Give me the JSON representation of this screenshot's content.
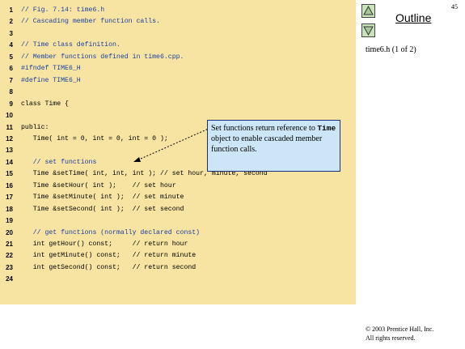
{
  "slide_number": "45",
  "outline_label": "Outline",
  "file_label": "time6.h (1 of 2)",
  "copyright": [
    "© 2003 Prentice Hall, Inc.",
    "All rights reserved."
  ],
  "callout": {
    "part1": "Set functions return reference to ",
    "code": "Time",
    "part2": " object to enable cascaded member function calls."
  },
  "code_lines": [
    {
      "n": "1",
      "t": "// Fig. 7.14: time6.h",
      "k": "cmt"
    },
    {
      "n": "2",
      "t": "// Cascading member function calls.",
      "k": "cmt"
    },
    {
      "n": "3",
      "t": "",
      "k": ""
    },
    {
      "n": "4",
      "t": "// Time class definition.",
      "k": "cmt"
    },
    {
      "n": "5",
      "t": "// Member functions defined in time6.cpp.",
      "k": "cmt"
    },
    {
      "n": "6",
      "t": "#ifndef TIME6_H",
      "k": "pp"
    },
    {
      "n": "7",
      "t": "#define TIME6_H",
      "k": "pp"
    },
    {
      "n": "8",
      "t": "",
      "k": ""
    },
    {
      "n": "9",
      "t": "class Time {",
      "k": ""
    },
    {
      "n": "10",
      "t": "",
      "k": ""
    },
    {
      "n": "11",
      "t": "public:",
      "k": ""
    },
    {
      "n": "12",
      "t": "   Time( int = 0, int = 0, int = 0 );",
      "k": ""
    },
    {
      "n": "13",
      "t": "",
      "k": ""
    },
    {
      "n": "14",
      "t": "   // set functions",
      "k": "cmt"
    },
    {
      "n": "15",
      "t": "   Time &setTime( int, int, int ); // set hour, minute, second",
      "k": ""
    },
    {
      "n": "16",
      "t": "   Time &setHour( int );    // set hour",
      "k": ""
    },
    {
      "n": "17",
      "t": "   Time &setMinute( int );  // set minute",
      "k": ""
    },
    {
      "n": "18",
      "t": "   Time &setSecond( int );  // set second",
      "k": ""
    },
    {
      "n": "19",
      "t": "",
      "k": ""
    },
    {
      "n": "20",
      "t": "   // get functions (normally declared const)",
      "k": "cmt"
    },
    {
      "n": "21",
      "t": "   int getHour() const;     // return hour",
      "k": ""
    },
    {
      "n": "22",
      "t": "   int getMinute() const;   // return minute",
      "k": ""
    },
    {
      "n": "23",
      "t": "   int getSecond() const;   // return second",
      "k": ""
    },
    {
      "n": "24",
      "t": "",
      "k": ""
    }
  ]
}
